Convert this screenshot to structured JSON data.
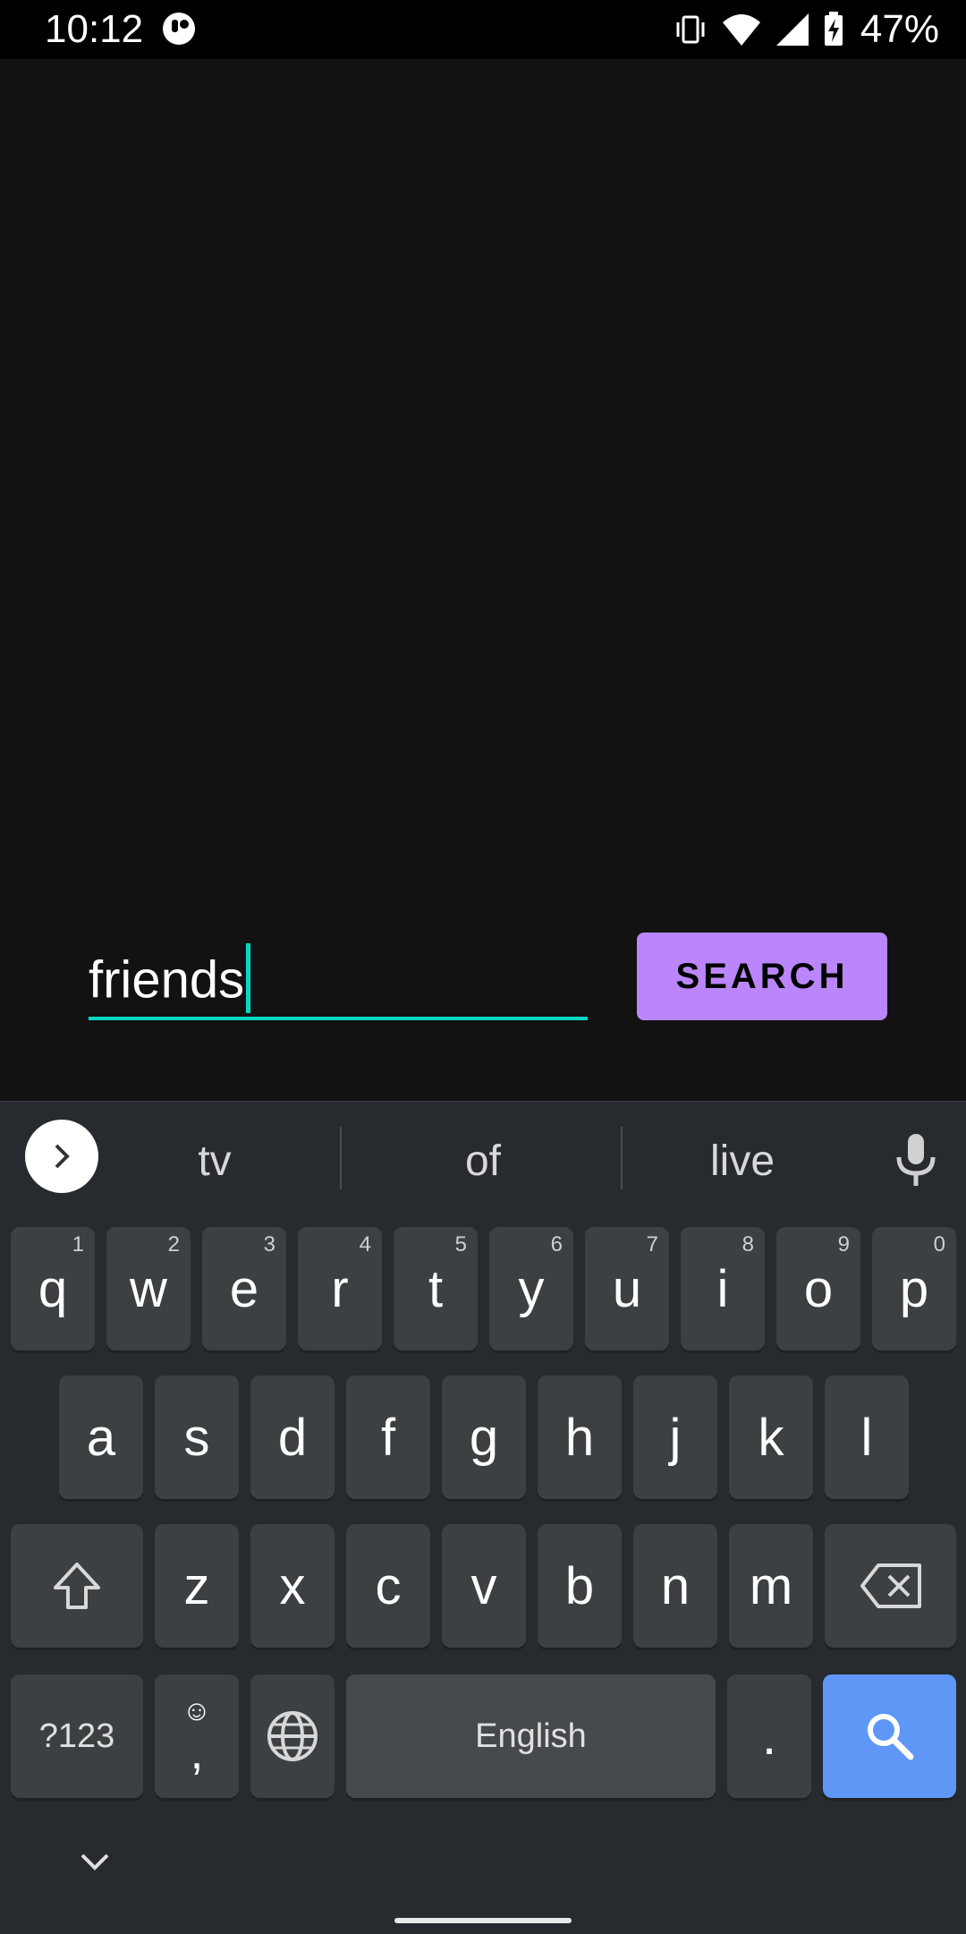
{
  "status_bar": {
    "time": "10:12",
    "battery": "47%"
  },
  "search": {
    "value": "friends",
    "button_label": "SEARCH"
  },
  "keyboard": {
    "suggestions": [
      "tv",
      "of",
      "live"
    ],
    "row1": [
      {
        "key": "q",
        "hint": "1"
      },
      {
        "key": "w",
        "hint": "2"
      },
      {
        "key": "e",
        "hint": "3"
      },
      {
        "key": "r",
        "hint": "4"
      },
      {
        "key": "t",
        "hint": "5"
      },
      {
        "key": "y",
        "hint": "6"
      },
      {
        "key": "u",
        "hint": "7"
      },
      {
        "key": "i",
        "hint": "8"
      },
      {
        "key": "o",
        "hint": "9"
      },
      {
        "key": "p",
        "hint": "0"
      }
    ],
    "row2": [
      "a",
      "s",
      "d",
      "f",
      "g",
      "h",
      "j",
      "k",
      "l"
    ],
    "row3": [
      "z",
      "x",
      "c",
      "v",
      "b",
      "n",
      "m"
    ],
    "symbols_label": "?123",
    "comma": ",",
    "space_label": "English",
    "period": "."
  },
  "colors": {
    "accent": "#03DAC5",
    "button": "#BB86FC",
    "search_key": "#5E97F6"
  },
  "icons": [
    "vibrate-icon",
    "wifi-icon",
    "signal-icon",
    "battery-icon",
    "mic-icon",
    "globe-icon",
    "backspace-icon",
    "shift-icon",
    "search-icon"
  ]
}
